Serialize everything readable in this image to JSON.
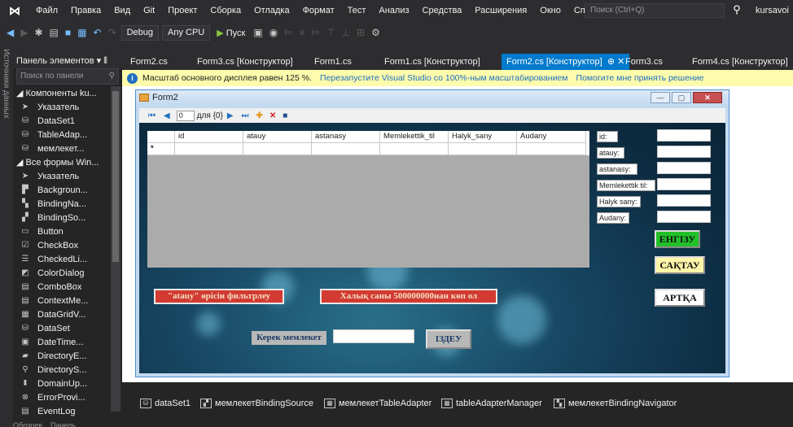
{
  "menubar": {
    "items": [
      "Файл",
      "Правка",
      "Вид",
      "Git",
      "Проект",
      "Сборка",
      "Отладка",
      "Формат",
      "Тест",
      "Анализ",
      "Средства",
      "Расширения",
      "Окно",
      "Справка"
    ],
    "search_placeholder": "Поиск (Ctrl+Q)",
    "user": "kursavoi"
  },
  "toolbar": {
    "config": "Debug",
    "platform": "Any CPU",
    "run_label": "Пуск"
  },
  "side_strip": {
    "label": "Источники данных"
  },
  "toolbox": {
    "title": "Панель элементов",
    "search_placeholder": "Поиск по панели",
    "items": [
      {
        "label": "Компоненты ku...",
        "type": "group",
        "icon": "triangle-down-icon"
      },
      {
        "label": "Указатель",
        "type": "item",
        "icon": "pointer-icon"
      },
      {
        "label": "DataSet1",
        "type": "item",
        "icon": "dataset-icon"
      },
      {
        "label": "TableAdap...",
        "type": "item",
        "icon": "table-adapter-icon"
      },
      {
        "label": "мемлекет...",
        "type": "item",
        "icon": "component-icon"
      },
      {
        "label": "Все формы Win...",
        "type": "group",
        "icon": "triangle-down-icon"
      },
      {
        "label": "Указатель",
        "type": "item",
        "icon": "pointer-icon"
      },
      {
        "label": "Backgroun...",
        "type": "item",
        "icon": "background-worker-icon"
      },
      {
        "label": "BindingNa...",
        "type": "item",
        "icon": "binding-navigator-icon"
      },
      {
        "label": "BindingSo...",
        "type": "item",
        "icon": "binding-source-icon"
      },
      {
        "label": "Button",
        "type": "item",
        "icon": "button-icon"
      },
      {
        "label": "CheckBox",
        "type": "item",
        "icon": "checkbox-icon"
      },
      {
        "label": "CheckedLi...",
        "type": "item",
        "icon": "checked-list-icon"
      },
      {
        "label": "ColorDialog",
        "type": "item",
        "icon": "color-dialog-icon"
      },
      {
        "label": "ComboBox",
        "type": "item",
        "icon": "combobox-icon"
      },
      {
        "label": "ContextMe...",
        "type": "item",
        "icon": "context-menu-icon"
      },
      {
        "label": "DataGridV...",
        "type": "item",
        "icon": "datagrid-icon"
      },
      {
        "label": "DataSet",
        "type": "item",
        "icon": "dataset-icon"
      },
      {
        "label": "DateTime...",
        "type": "item",
        "icon": "datetime-icon"
      },
      {
        "label": "DirectoryE...",
        "type": "item",
        "icon": "directory-entry-icon"
      },
      {
        "label": "DirectoryS...",
        "type": "item",
        "icon": "directory-searcher-icon"
      },
      {
        "label": "DomainUp...",
        "type": "item",
        "icon": "domain-updown-icon"
      },
      {
        "label": "ErrorProvi...",
        "type": "item",
        "icon": "error-provider-icon"
      },
      {
        "label": "EventLog",
        "type": "item",
        "icon": "event-log-icon"
      }
    ],
    "footer": "Обозрев... Панель..."
  },
  "tabs": [
    {
      "label": "Form2.cs",
      "active": false
    },
    {
      "label": "Form3.cs [Конструктор]",
      "active": false
    },
    {
      "label": "Form1.cs",
      "active": false
    },
    {
      "label": "Form1.cs [Конструктор]",
      "active": false
    },
    {
      "label": "Form2.cs [Конструктор]",
      "active": true
    },
    {
      "label": "Form3.cs",
      "active": false
    },
    {
      "label": "Form4.cs [Конструктор]",
      "active": false
    }
  ],
  "infobar": {
    "message": "Масштаб основного дисплея равен 125 %.",
    "link_restart": "Перезапустите Visual Studio со 100%-ным масштабированием",
    "link_help": "Помогите мне принять решение"
  },
  "form": {
    "title": "Form2",
    "navigator": {
      "position": "0",
      "count": "для {0}"
    },
    "grid": {
      "columns": [
        "id",
        "atauy",
        "astanasy",
        "Memlekettik_til",
        "Halyk_sany",
        "Audany"
      ],
      "new_row_marker": "*"
    },
    "field_labels": [
      "id:",
      "atauy:",
      "astanasy:",
      "Memlekettik til:",
      "Halyk sany:",
      "Audany:"
    ],
    "buttons": {
      "insert": "ЕНГІЗУ",
      "save": "САҚТАУ",
      "back": "АРТҚА",
      "filter_name": "\"atauy\" өрісін фильтрлеу",
      "filter_population": "Халық саны 500000000нан көп ол",
      "search": "ІЗДЕУ"
    },
    "search_label": "Керек мемлекет"
  },
  "tray": {
    "items": [
      {
        "label": "dataSet1",
        "icon": "dataset-icon"
      },
      {
        "label": "мемлекетBindingSource",
        "icon": "binding-source-icon"
      },
      {
        "label": "мемлекетTableAdapter",
        "icon": "table-adapter-icon"
      },
      {
        "label": "tableAdapterManager",
        "icon": "table-adapter-manager-icon"
      },
      {
        "label": "мемлекетBindingNavigator",
        "icon": "binding-navigator-icon"
      }
    ]
  },
  "colors": {
    "accent": "#007acc",
    "infobar_bg": "#fdfbac",
    "insert_button": "#22c12a",
    "save_button": "#fff6a8",
    "back_button": "#ffffff",
    "filter_button": "#d23a32"
  }
}
